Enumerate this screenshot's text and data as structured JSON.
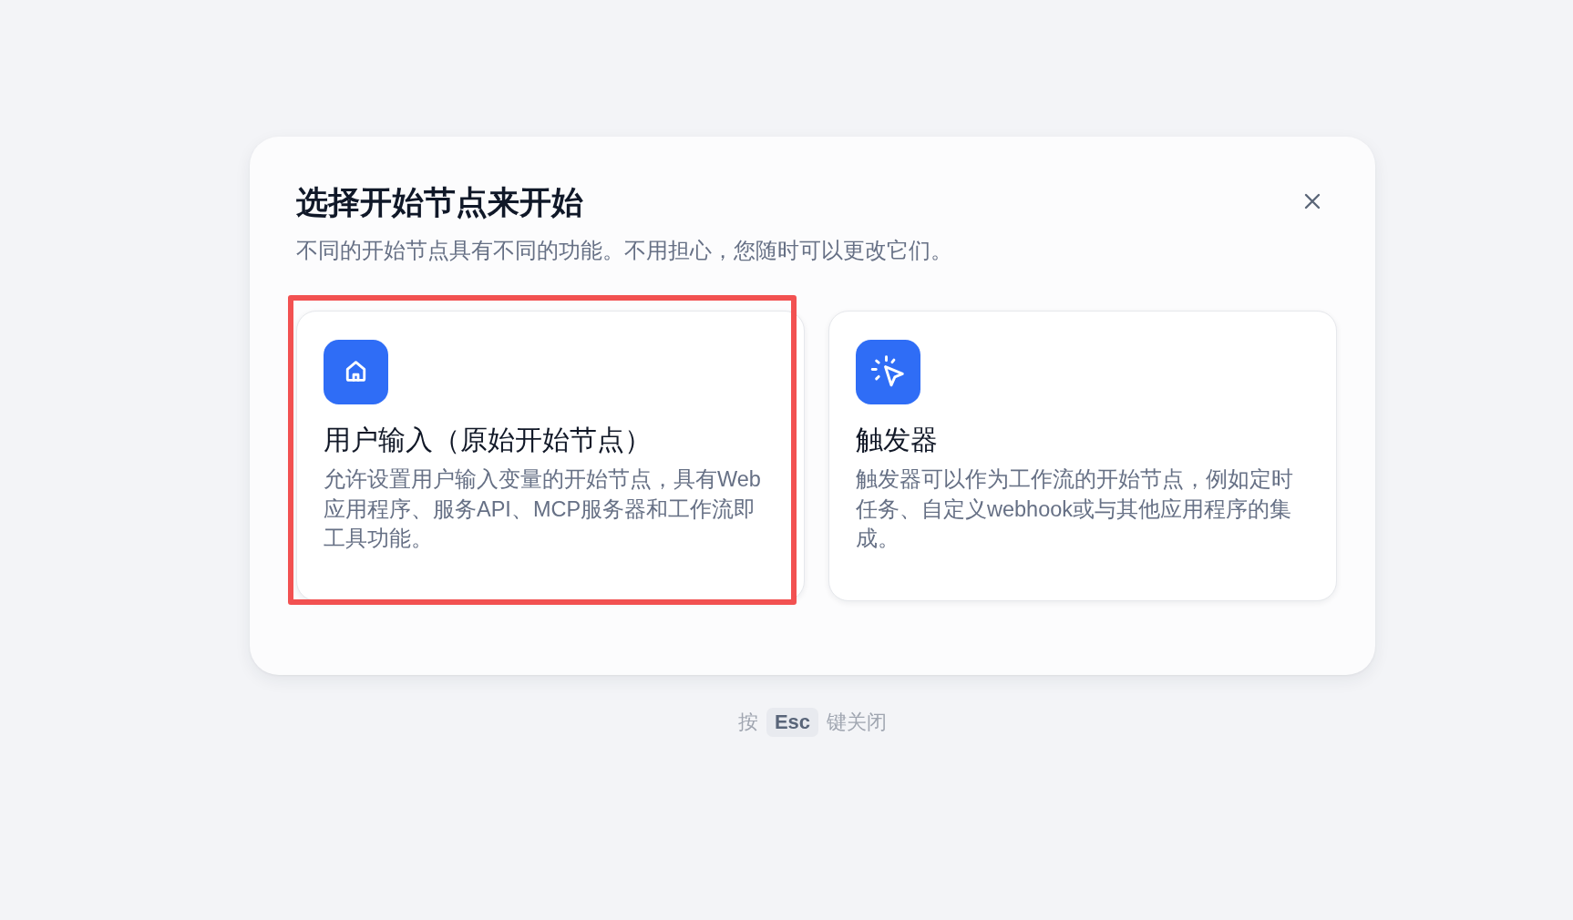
{
  "dialog": {
    "title": "选择开始节点来开始",
    "subtitle": "不同的开始节点具有不同的功能。不用担心，您随时可以更改它们。"
  },
  "cards": [
    {
      "kind": "home",
      "title": "用户输入（原始开始节点）",
      "description": "允许设置用户输入变量的开始节点，具有Web应用程序、服务API、MCP服务器和工作流即工具功能。",
      "highlighted": true
    },
    {
      "kind": "trigger",
      "title": "触发器",
      "description": "触发器可以作为工作流的开始节点，例如定时任务、自定义webhook或与其他应用程序的集成。",
      "highlighted": false
    }
  ],
  "footer": {
    "before": "按",
    "key": "Esc",
    "after": "键关闭"
  }
}
